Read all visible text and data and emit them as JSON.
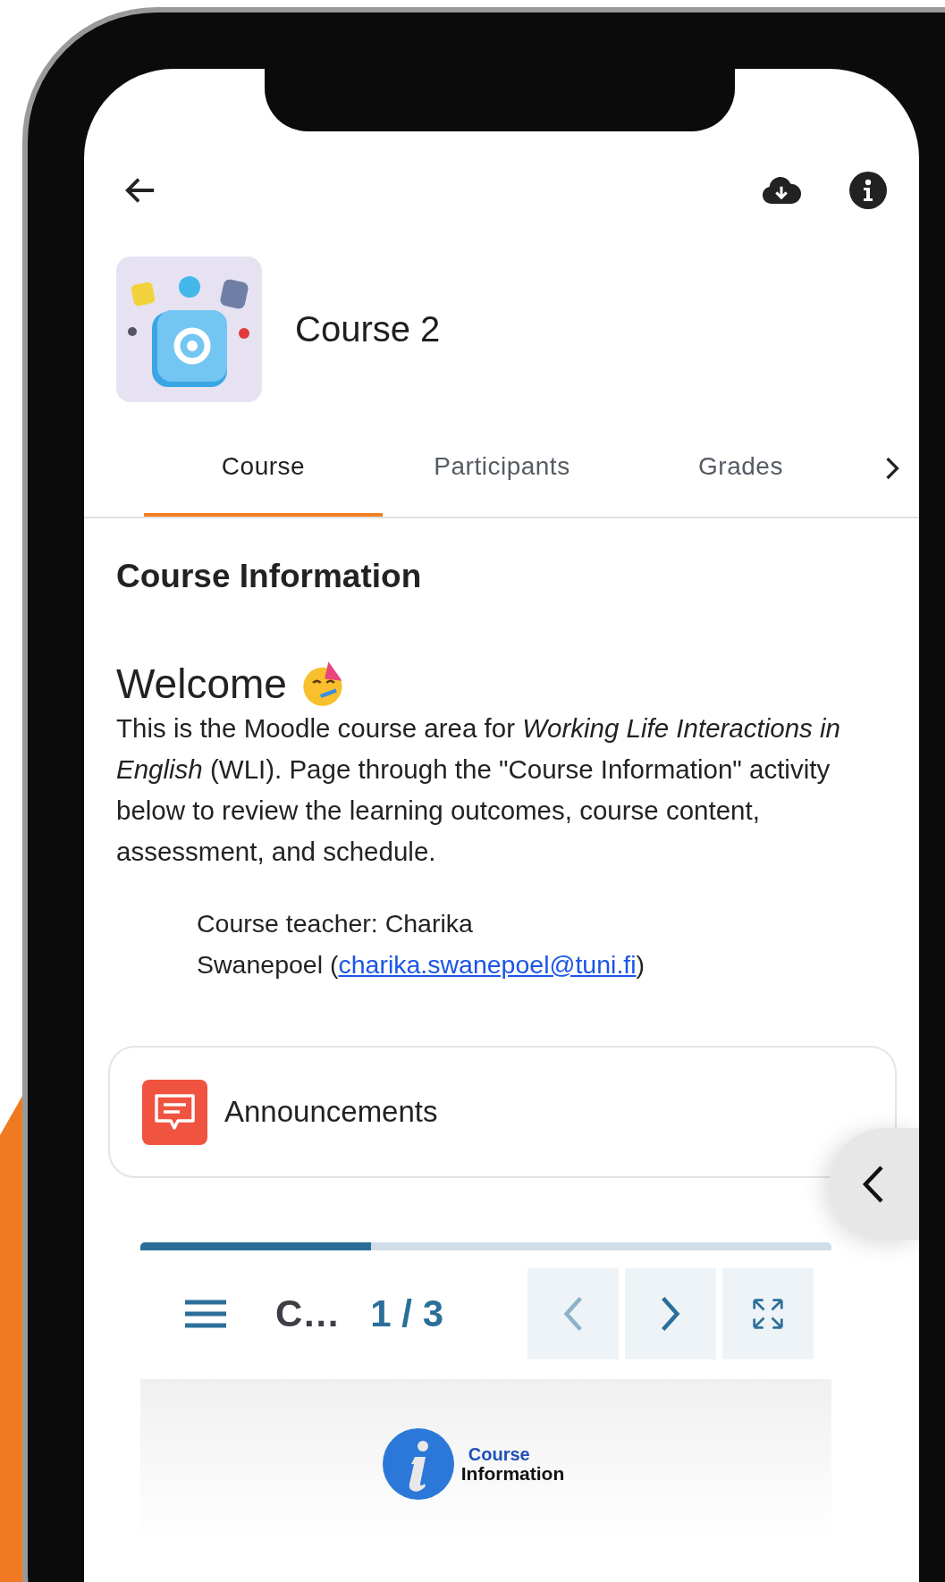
{
  "course": {
    "title": "Course 2"
  },
  "tabs": [
    {
      "label": "Course",
      "selected": true
    },
    {
      "label": "Participants",
      "selected": false
    },
    {
      "label": "Grades",
      "selected": false
    }
  ],
  "section": {
    "title": "Course Information"
  },
  "welcome": {
    "heading": "Welcome",
    "body": "This is the Moodle course area for *Working Life Interactions in English* (WLI). Page through the \"Course Information\" activity below to review the learning outcomes, course content, assessment, and schedule.",
    "teacher_prefix": "Course teacher: Charika\nSwanepoel (",
    "teacher_email": "charika.swanepoel@tuni.fi",
    "teacher_suffix": ")"
  },
  "module": {
    "name": "Announcements"
  },
  "book": {
    "progress": {
      "level": 0.334
    },
    "chapter": "C…",
    "page_indicator": "1 / 3",
    "nav_buttons": [
      {
        "kind": "prev",
        "disabled": true
      },
      {
        "kind": "next",
        "disabled": false
      },
      {
        "kind": "fullscreen",
        "disabled": false
      }
    ]
  },
  "slide": {
    "logo_line1": "Course",
    "logo_line2": "Information"
  }
}
